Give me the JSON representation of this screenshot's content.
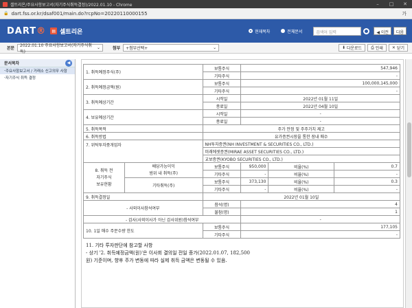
{
  "window": {
    "title": "셀트리온/주요사항보고서(자기주식취득결정)/2022.01.10 - Chrome",
    "min": "–",
    "max": "□",
    "close": "✕"
  },
  "address": {
    "url": "dart.fss.or.kr/dsaf001/main.do?rcpNo=20220110000155",
    "lang": "가"
  },
  "header": {
    "logo_main": "DART",
    "logo_dot": "®",
    "company_icon": "▤",
    "company": "셀트리온",
    "radio_current": "현재목차",
    "radio_all": "전체문서",
    "search_placeholder": "검색어 입력",
    "prev": "◀ 이전",
    "next": "다음"
  },
  "filter": {
    "label1": "본문",
    "doc_select": "2022.01.10 주요사항보고서(자기주식취득)",
    "label2": "첨부",
    "attach_select": "+첨부선택+",
    "download": "다운로드",
    "print": "인쇄",
    "close": "닫기"
  },
  "sidebar": {
    "title": "문서목차",
    "items": [
      "주요사항보고서 / 거래소 신고의무 사항",
      "자기주식 취득 결정"
    ]
  },
  "table": {
    "rows": [
      {
        "no": "1. 취득예정주식(주)",
        "a": "보통주식",
        "v": "547,946"
      },
      {
        "no": "",
        "a": "기타주식",
        "v": "-"
      },
      {
        "no": "2. 취득예정금액(원)",
        "a": "보통주식",
        "v": "100,000,145,000"
      },
      {
        "no": "",
        "a": "기타주식",
        "v": "-"
      },
      {
        "no": "3. 취득예상기간",
        "a": "시작일",
        "v": "2022년 01월 11일"
      },
      {
        "no": "",
        "a": "종료일",
        "v": "2022년 04월 10일"
      },
      {
        "no": "4. 보유예상기간",
        "a": "시작일",
        "v": "-"
      },
      {
        "no": "",
        "a": "종료일",
        "v": "-"
      },
      {
        "no": "5. 취득목적",
        "v": "주가 안정 및 주주가치 제고"
      },
      {
        "no": "6. 취득방법",
        "v": "유가증권시장을 통한 장내 매수"
      },
      {
        "no": "7. 위탁투자중개업자",
        "v1": "NH투자증권(NH INVESTMENT & SECURITIES CO., LTD.)",
        "v2": "미래에셋증권(MIRAE ASSET SECURITIES CO., LTD.)",
        "v3": "교보증권(KYOBO SECURITIES CO., LTD.)"
      },
      {
        "no1": "8. 취득 전",
        "no2": "자기주식",
        "no3": "보유현황",
        "g1a": "배당가능이익",
        "g1b": "범위 내 취득(주)",
        "g2": "기타취득(주)",
        "s1": "보통주식",
        "s2": "기타주식",
        "n1": "950,000",
        "n2": "-",
        "n3": "373,130",
        "n4": "-",
        "rl": "비율(%)",
        "r1": "0.7",
        "r2": "-",
        "r3": "0.3",
        "r4": "-"
      },
      {
        "no": "9. 취득결정일",
        "v": "2022년 01월 10일"
      },
      {
        "no": "- 사외이사참석여부",
        "a": "참석(명)",
        "v": "4"
      },
      {
        "no": "",
        "a": "불참(명)",
        "v": "1"
      },
      {
        "no": "- 감사(사외이사가 아닌 감사위원)참석여부",
        "v": "-"
      },
      {
        "no": "10. 1일 매수 주문수량 한도",
        "a": "보통주식",
        "v": "177,105"
      },
      {
        "no": "",
        "a": "기타주식",
        "v": "-"
      }
    ]
  },
  "note": {
    "title": "11. 기타 투자판단에 참고할 사항",
    "l1": "- 상기 '2. 취득예정금액(원)'은 이사회 결의일 전일 종가(2022.01.07, 182,500",
    "l2": "원) 기준이며, 향후 주가 변동에 따라 실제 취득 금액은 변동될 수 있음."
  }
}
